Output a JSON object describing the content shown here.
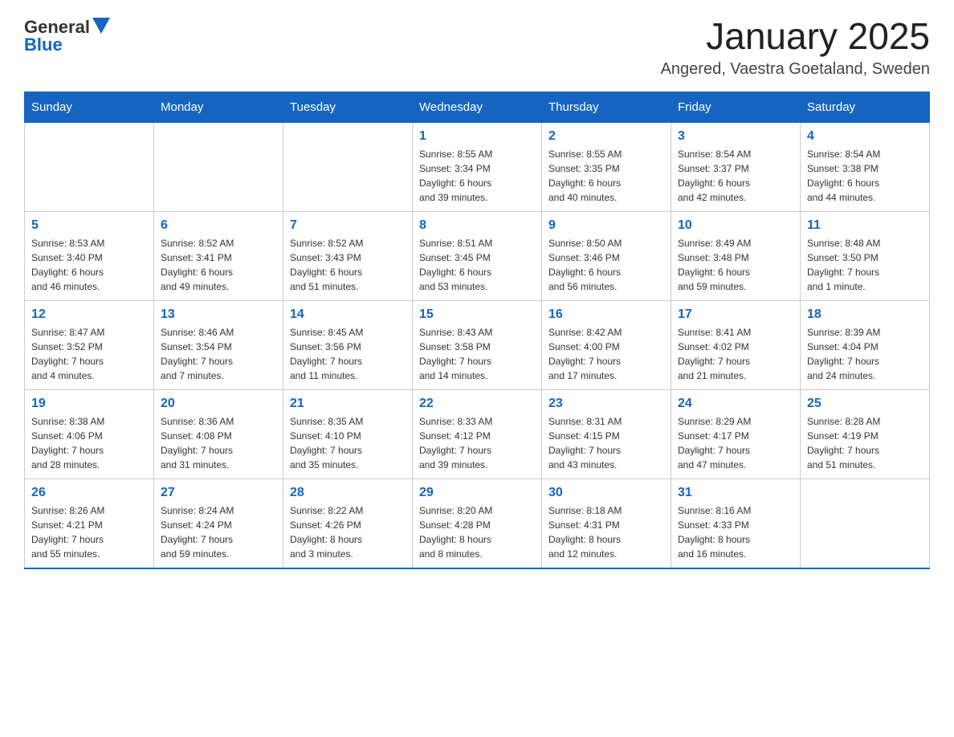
{
  "header": {
    "logo_general": "General",
    "logo_blue": "Blue",
    "title": "January 2025",
    "subtitle": "Angered, Vaestra Goetaland, Sweden"
  },
  "days_of_week": [
    "Sunday",
    "Monday",
    "Tuesday",
    "Wednesday",
    "Thursday",
    "Friday",
    "Saturday"
  ],
  "weeks": [
    [
      {
        "day": "",
        "info": ""
      },
      {
        "day": "",
        "info": ""
      },
      {
        "day": "",
        "info": ""
      },
      {
        "day": "1",
        "info": "Sunrise: 8:55 AM\nSunset: 3:34 PM\nDaylight: 6 hours\nand 39 minutes."
      },
      {
        "day": "2",
        "info": "Sunrise: 8:55 AM\nSunset: 3:35 PM\nDaylight: 6 hours\nand 40 minutes."
      },
      {
        "day": "3",
        "info": "Sunrise: 8:54 AM\nSunset: 3:37 PM\nDaylight: 6 hours\nand 42 minutes."
      },
      {
        "day": "4",
        "info": "Sunrise: 8:54 AM\nSunset: 3:38 PM\nDaylight: 6 hours\nand 44 minutes."
      }
    ],
    [
      {
        "day": "5",
        "info": "Sunrise: 8:53 AM\nSunset: 3:40 PM\nDaylight: 6 hours\nand 46 minutes."
      },
      {
        "day": "6",
        "info": "Sunrise: 8:52 AM\nSunset: 3:41 PM\nDaylight: 6 hours\nand 49 minutes."
      },
      {
        "day": "7",
        "info": "Sunrise: 8:52 AM\nSunset: 3:43 PM\nDaylight: 6 hours\nand 51 minutes."
      },
      {
        "day": "8",
        "info": "Sunrise: 8:51 AM\nSunset: 3:45 PM\nDaylight: 6 hours\nand 53 minutes."
      },
      {
        "day": "9",
        "info": "Sunrise: 8:50 AM\nSunset: 3:46 PM\nDaylight: 6 hours\nand 56 minutes."
      },
      {
        "day": "10",
        "info": "Sunrise: 8:49 AM\nSunset: 3:48 PM\nDaylight: 6 hours\nand 59 minutes."
      },
      {
        "day": "11",
        "info": "Sunrise: 8:48 AM\nSunset: 3:50 PM\nDaylight: 7 hours\nand 1 minute."
      }
    ],
    [
      {
        "day": "12",
        "info": "Sunrise: 8:47 AM\nSunset: 3:52 PM\nDaylight: 7 hours\nand 4 minutes."
      },
      {
        "day": "13",
        "info": "Sunrise: 8:46 AM\nSunset: 3:54 PM\nDaylight: 7 hours\nand 7 minutes."
      },
      {
        "day": "14",
        "info": "Sunrise: 8:45 AM\nSunset: 3:56 PM\nDaylight: 7 hours\nand 11 minutes."
      },
      {
        "day": "15",
        "info": "Sunrise: 8:43 AM\nSunset: 3:58 PM\nDaylight: 7 hours\nand 14 minutes."
      },
      {
        "day": "16",
        "info": "Sunrise: 8:42 AM\nSunset: 4:00 PM\nDaylight: 7 hours\nand 17 minutes."
      },
      {
        "day": "17",
        "info": "Sunrise: 8:41 AM\nSunset: 4:02 PM\nDaylight: 7 hours\nand 21 minutes."
      },
      {
        "day": "18",
        "info": "Sunrise: 8:39 AM\nSunset: 4:04 PM\nDaylight: 7 hours\nand 24 minutes."
      }
    ],
    [
      {
        "day": "19",
        "info": "Sunrise: 8:38 AM\nSunset: 4:06 PM\nDaylight: 7 hours\nand 28 minutes."
      },
      {
        "day": "20",
        "info": "Sunrise: 8:36 AM\nSunset: 4:08 PM\nDaylight: 7 hours\nand 31 minutes."
      },
      {
        "day": "21",
        "info": "Sunrise: 8:35 AM\nSunset: 4:10 PM\nDaylight: 7 hours\nand 35 minutes."
      },
      {
        "day": "22",
        "info": "Sunrise: 8:33 AM\nSunset: 4:12 PM\nDaylight: 7 hours\nand 39 minutes."
      },
      {
        "day": "23",
        "info": "Sunrise: 8:31 AM\nSunset: 4:15 PM\nDaylight: 7 hours\nand 43 minutes."
      },
      {
        "day": "24",
        "info": "Sunrise: 8:29 AM\nSunset: 4:17 PM\nDaylight: 7 hours\nand 47 minutes."
      },
      {
        "day": "25",
        "info": "Sunrise: 8:28 AM\nSunset: 4:19 PM\nDaylight: 7 hours\nand 51 minutes."
      }
    ],
    [
      {
        "day": "26",
        "info": "Sunrise: 8:26 AM\nSunset: 4:21 PM\nDaylight: 7 hours\nand 55 minutes."
      },
      {
        "day": "27",
        "info": "Sunrise: 8:24 AM\nSunset: 4:24 PM\nDaylight: 7 hours\nand 59 minutes."
      },
      {
        "day": "28",
        "info": "Sunrise: 8:22 AM\nSunset: 4:26 PM\nDaylight: 8 hours\nand 3 minutes."
      },
      {
        "day": "29",
        "info": "Sunrise: 8:20 AM\nSunset: 4:28 PM\nDaylight: 8 hours\nand 8 minutes."
      },
      {
        "day": "30",
        "info": "Sunrise: 8:18 AM\nSunset: 4:31 PM\nDaylight: 8 hours\nand 12 minutes."
      },
      {
        "day": "31",
        "info": "Sunrise: 8:16 AM\nSunset: 4:33 PM\nDaylight: 8 hours\nand 16 minutes."
      },
      {
        "day": "",
        "info": ""
      }
    ]
  ]
}
